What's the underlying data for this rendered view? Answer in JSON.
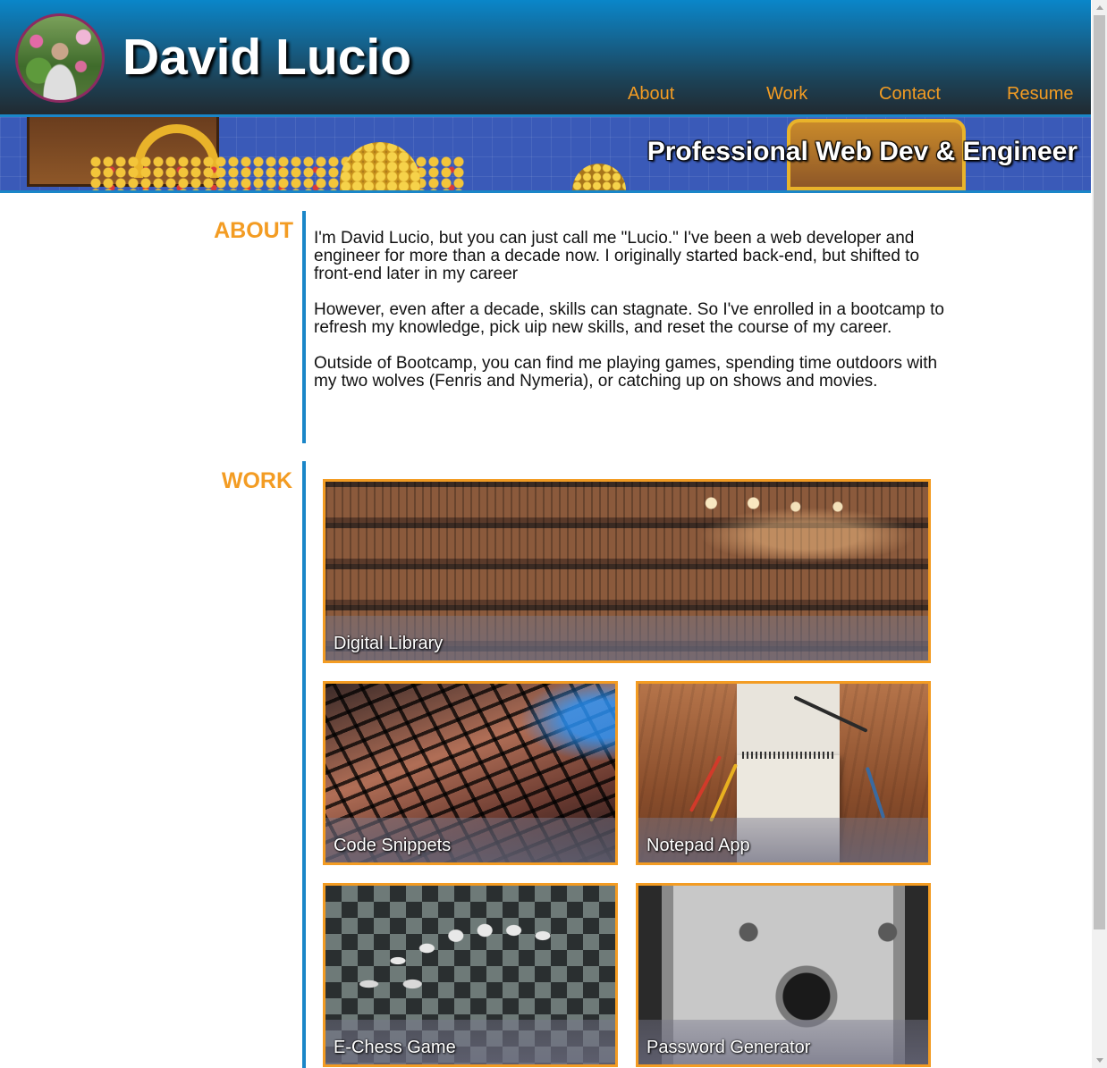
{
  "header": {
    "title": "David Lucio",
    "nav": [
      "About",
      "Work",
      "Contact",
      "Resume"
    ]
  },
  "banner": {
    "tagline": "Professional Web Dev & Engineer"
  },
  "about": {
    "heading": "ABOUT",
    "paragraphs": [
      "I'm David Lucio, but you can just call me \"Lucio.\" I've been a web developer and engineer for more than a decade now. I originally started back-end, but shifted to front-end later in my career",
      "However, even after a decade, skills can stagnate. So I've enrolled in a bootcamp to refresh my knowledge, pick uip new skills, and reset the course of my career.",
      "Outside of Bootcamp, you can find me playing games, spending time outdoors with my two wolves (Fenris and Nymeria), or catching up on shows and movies."
    ]
  },
  "work": {
    "heading": "WORK",
    "projects": [
      "Digital Library",
      "Code Snippets",
      "Notepad App",
      "E-Chess Game",
      "Password Generator"
    ]
  },
  "colors": {
    "accent": "#f39c23",
    "blue": "#1a86c8",
    "header_dark": "#212a31"
  }
}
